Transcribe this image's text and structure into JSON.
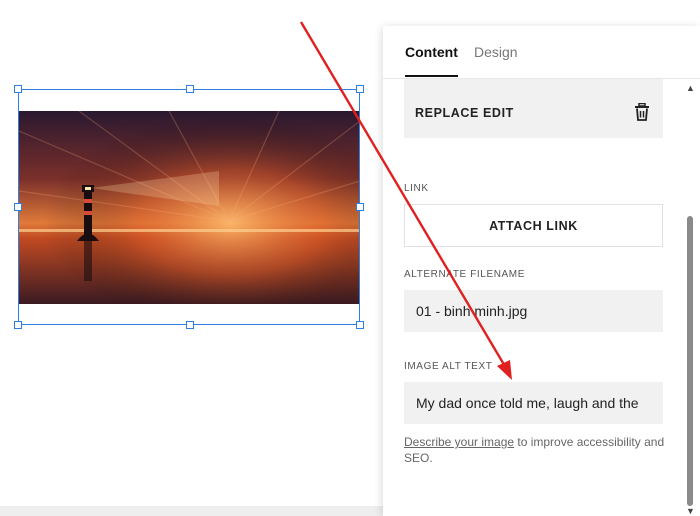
{
  "panel": {
    "tabs": [
      "Content",
      "Design"
    ],
    "active_tab": "Content",
    "image_actions": {
      "replace": "REPLACE",
      "edit": "EDIT"
    },
    "link": {
      "label": "LINK",
      "button": "ATTACH LINK"
    },
    "alternate_filename": {
      "label": "ALTERNATE FILENAME",
      "value": "01 - binh minh.jpg"
    },
    "alt_text": {
      "label": "IMAGE ALT TEXT",
      "value": "My dad once told me, laugh and the"
    },
    "help": {
      "link_text": "Describe your image",
      "rest": " to improve accessibility and SEO."
    }
  },
  "colors": {
    "selection": "#2f7fe0",
    "annotation_arrow": "#e02020",
    "field_bg": "#f1f1f1"
  },
  "icons": [
    "trash-icon",
    "scroll-up-icon",
    "scroll-down-icon"
  ]
}
